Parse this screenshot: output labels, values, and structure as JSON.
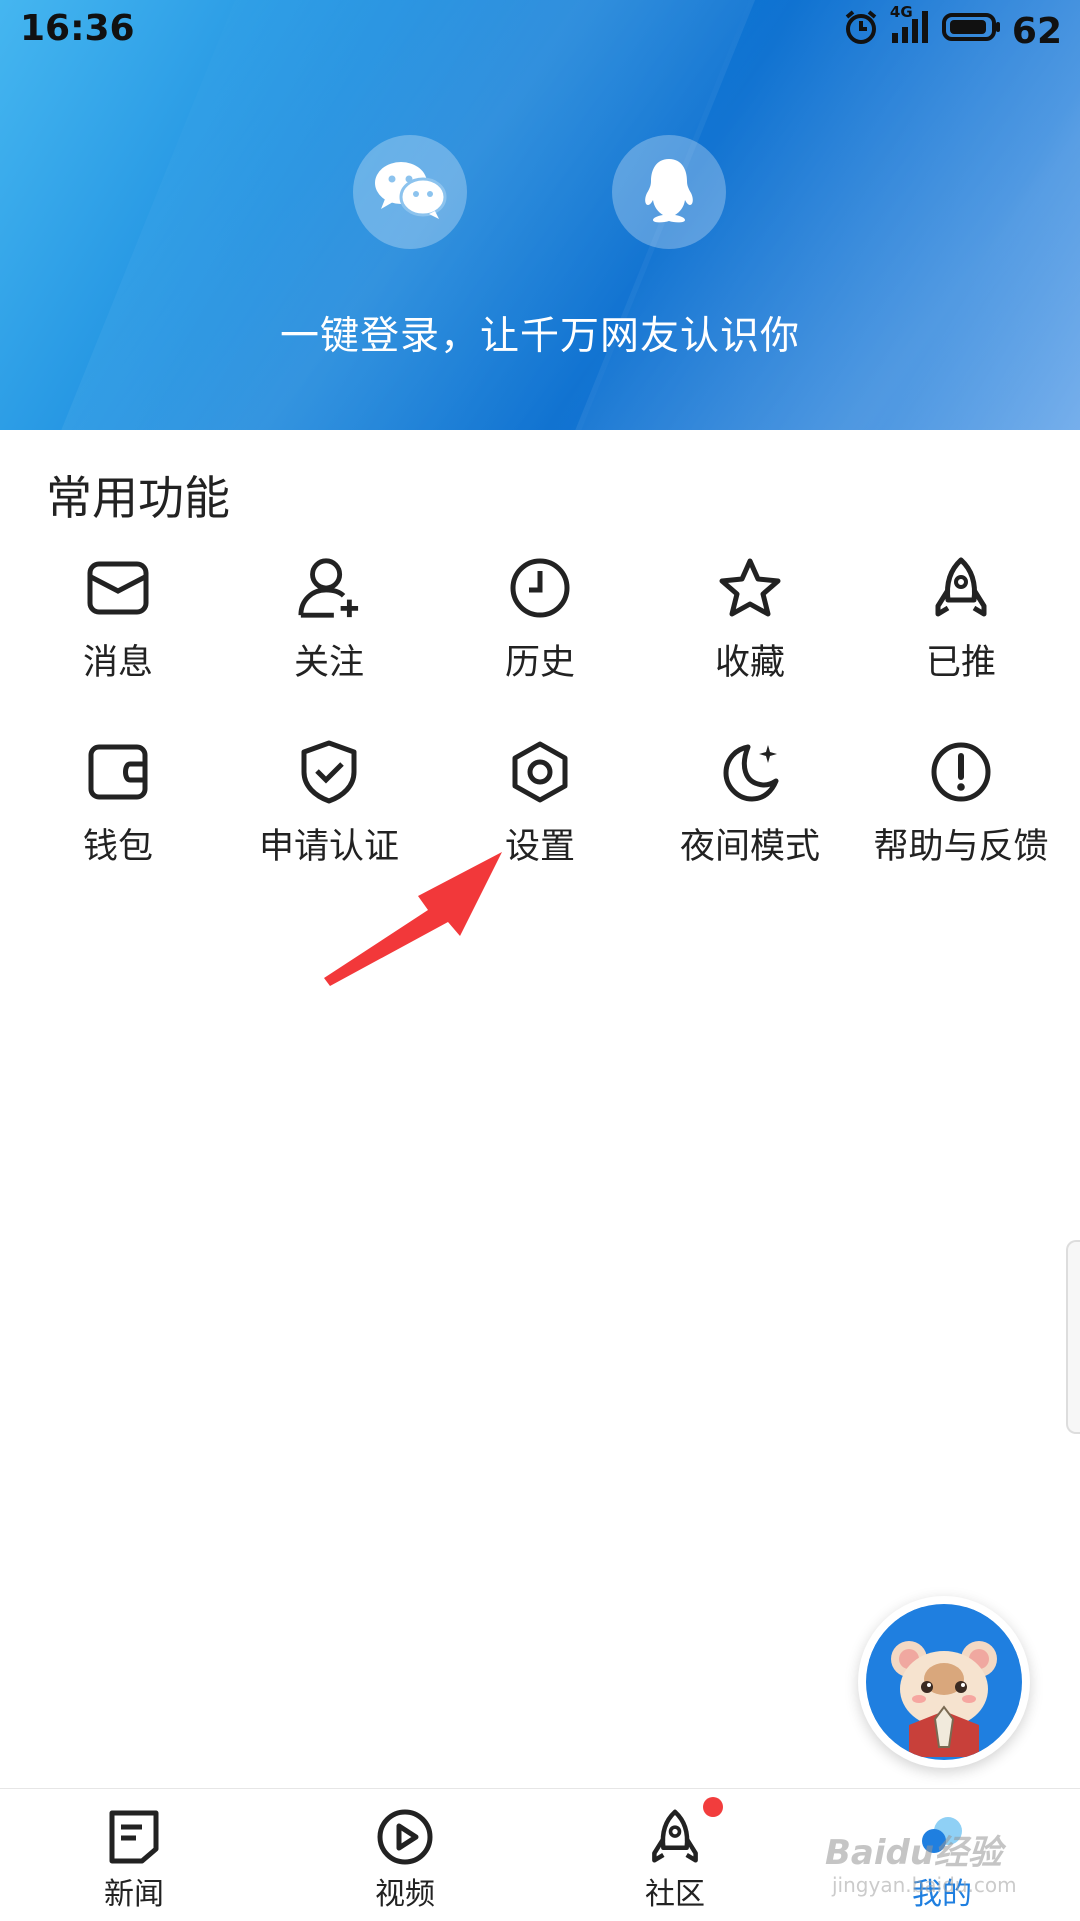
{
  "status_bar": {
    "time": "16:36",
    "network": "4G",
    "battery": "62",
    "icons": [
      "alarm-icon",
      "signal-icon",
      "battery-icon"
    ]
  },
  "header": {
    "login_options": [
      {
        "name": "wechat",
        "icon": "wechat-icon"
      },
      {
        "name": "qq",
        "icon": "qq-penguin-icon"
      }
    ],
    "caption": "一键登录，让千万网友认识你"
  },
  "section": {
    "title": "常用功能",
    "items": [
      {
        "label": "消息",
        "icon": "message-envelope-icon"
      },
      {
        "label": "关注",
        "icon": "follow-user-plus-icon"
      },
      {
        "label": "历史",
        "icon": "history-clock-icon"
      },
      {
        "label": "收藏",
        "icon": "favorite-star-icon"
      },
      {
        "label": "已推",
        "icon": "pushed-rocket-icon"
      },
      {
        "label": "钱包",
        "icon": "wallet-icon"
      },
      {
        "label": "申请认证",
        "icon": "certification-shield-icon"
      },
      {
        "label": "设置",
        "icon": "settings-hexagon-icon"
      },
      {
        "label": "夜间模式",
        "icon": "night-mode-moon-icon"
      },
      {
        "label": "帮助与反馈",
        "icon": "help-feedback-icon"
      }
    ]
  },
  "bottom_nav": {
    "items": [
      {
        "label": "新闻",
        "icon": "news-icon"
      },
      {
        "label": "视频",
        "icon": "video-play-icon"
      },
      {
        "label": "社区",
        "icon": "community-rocket-icon",
        "badge_dot": true
      },
      {
        "label": "我的",
        "icon": "profile-icon",
        "active": true
      }
    ]
  },
  "watermark": {
    "text": "Baidu经验",
    "sub": "jingyan.baidu.com"
  },
  "colors": {
    "accent": "#1f7fe0",
    "badge": "#f23d3d",
    "annotation_arrow": "#f2383a"
  }
}
